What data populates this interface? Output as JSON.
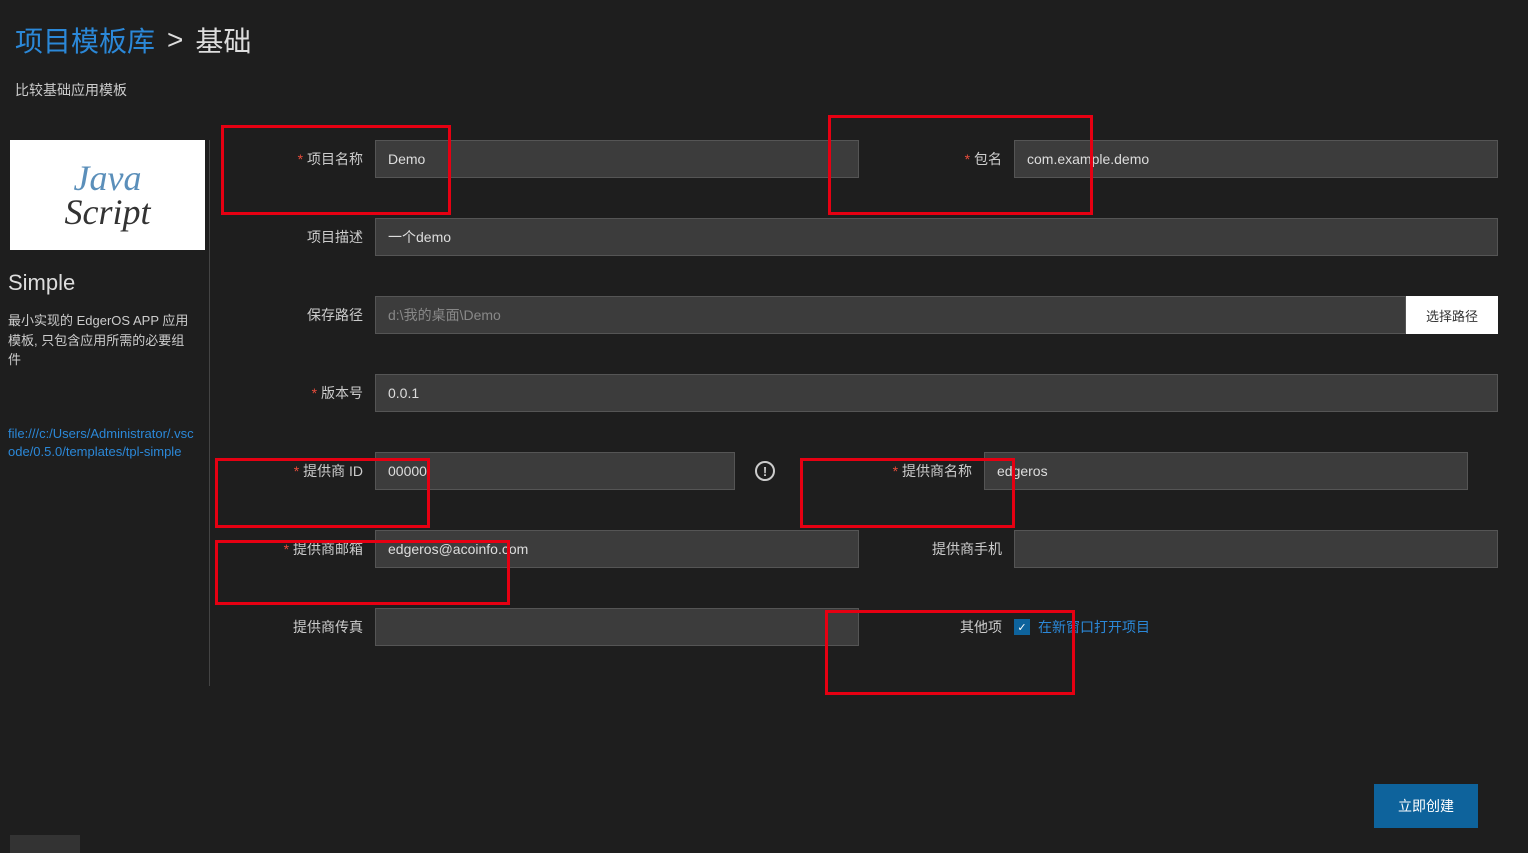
{
  "header": {
    "breadcrumb_link": "项目模板库",
    "breadcrumb_sep": ">",
    "breadcrumb_current": "基础",
    "subtitle": "比较基础应用模板"
  },
  "sidebar": {
    "logo_top": "Java",
    "logo_bottom": "Script",
    "title": "Simple",
    "desc": "最小实现的 EdgerOS APP 应用模板, 只包含应用所需的必要组件",
    "link": "file:///c:/Users/Administrator/.vscode/0.5.0/templates/tpl-simple"
  },
  "form": {
    "project_name": {
      "label": "项目名称",
      "value": "Demo"
    },
    "package_name": {
      "label": "包名",
      "value": "com.example.demo"
    },
    "description": {
      "label": "项目描述",
      "value": "一个demo"
    },
    "save_path": {
      "label": "保存路径",
      "value": "d:\\我的桌面\\Demo",
      "browse": "选择路径"
    },
    "version": {
      "label": "版本号",
      "value": "0.0.1"
    },
    "vendor_id": {
      "label": "提供商 ID",
      "value": "00000"
    },
    "vendor_name": {
      "label": "提供商名称",
      "value": "edgeros"
    },
    "vendor_email": {
      "label": "提供商邮箱",
      "value": "edgeros@acoinfo.com"
    },
    "vendor_phone": {
      "label": "提供商手机",
      "value": ""
    },
    "vendor_fax": {
      "label": "提供商传真",
      "value": ""
    },
    "other": {
      "label": "其他项",
      "checkbox_label": "在新窗口打开项目",
      "checked": true
    }
  },
  "buttons": {
    "create": "立即创建"
  },
  "info_icon": "!"
}
